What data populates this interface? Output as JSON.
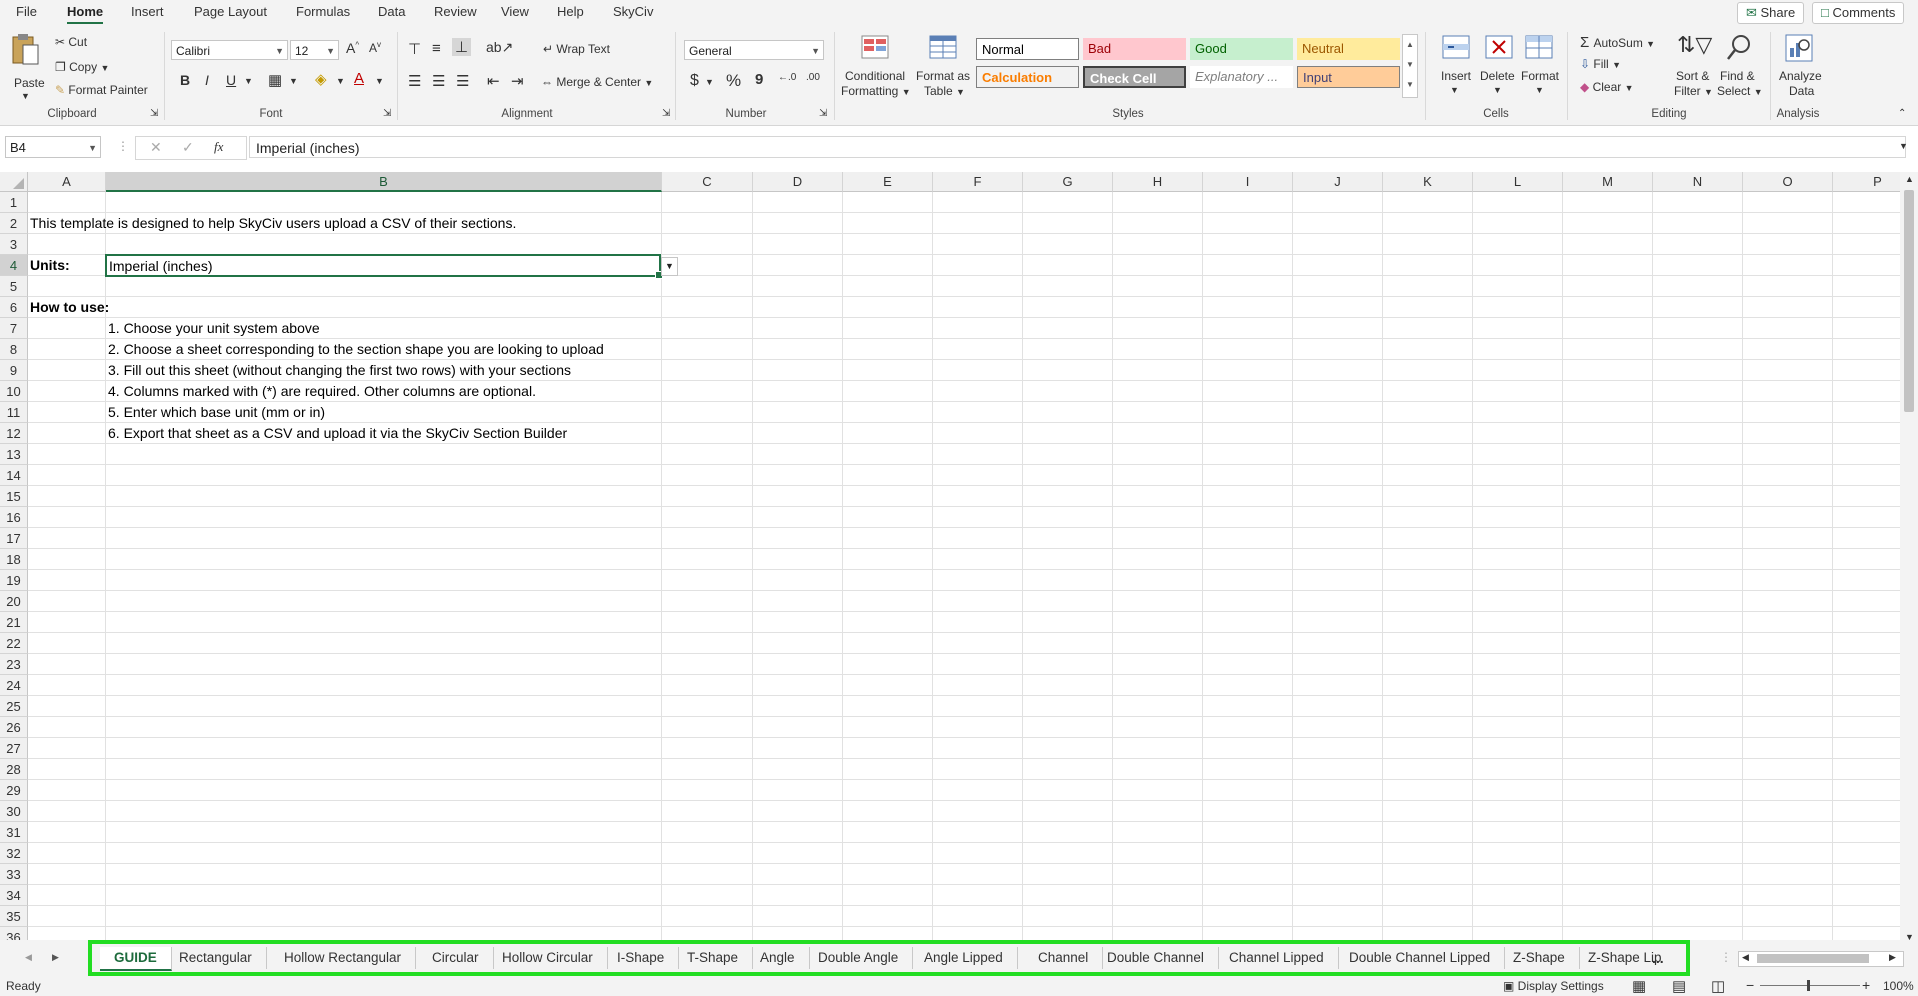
{
  "menu": {
    "tabs": [
      "File",
      "Home",
      "Insert",
      "Page Layout",
      "Formulas",
      "Data",
      "Review",
      "View",
      "Help",
      "SkyCiv"
    ],
    "share": "Share",
    "comments": "Comments"
  },
  "ribbon": {
    "clipboard": {
      "paste": "Paste",
      "cut": "Cut",
      "copy": "Copy",
      "format_painter": "Format Painter",
      "label": "Clipboard"
    },
    "font": {
      "name": "Calibri",
      "size": "12",
      "bold": "B",
      "italic": "I",
      "underline": "U",
      "label": "Font"
    },
    "alignment": {
      "wrap": "Wrap Text",
      "merge": "Merge & Center",
      "label": "Alignment"
    },
    "number": {
      "format": "General",
      "currency": "$",
      "percent": "%",
      "comma": "9",
      "label": "Number"
    },
    "styles": {
      "conditional_1": "Conditional",
      "conditional_2": "Formatting",
      "format_table_1": "Format as",
      "format_table_2": "Table",
      "cells": [
        {
          "text": "Normal",
          "bg": "#ffffff",
          "fg": "#000000"
        },
        {
          "text": "Bad",
          "bg": "#ffc7ce",
          "fg": "#9c0006"
        },
        {
          "text": "Good",
          "bg": "#c6efce",
          "fg": "#006100"
        },
        {
          "text": "Neutral",
          "bg": "#ffeb9c",
          "fg": "#9c5700"
        },
        {
          "text": "Calculation",
          "bg": "#f2f2f2",
          "fg": "#fa7d00"
        },
        {
          "text": "Check Cell",
          "bg": "#a5a5a5",
          "fg": "#ffffff"
        },
        {
          "text": "Explanatory ...",
          "bg": "#ffffff",
          "fg": "#7f7f7f"
        },
        {
          "text": "Input",
          "bg": "#ffcc99",
          "fg": "#3f3f76"
        }
      ],
      "label": "Styles"
    },
    "cells": {
      "insert": "Insert",
      "delete": "Delete",
      "format": "Format",
      "label": "Cells"
    },
    "editing": {
      "autosum": "AutoSum",
      "fill": "Fill",
      "clear": "Clear",
      "sort_1": "Sort &",
      "sort_2": "Filter",
      "find_1": "Find &",
      "find_2": "Select",
      "label": "Editing"
    },
    "analysis": {
      "analyze_1": "Analyze",
      "analyze_2": "Data",
      "label": "Analysis"
    }
  },
  "formula_bar": {
    "name_box": "B4",
    "fx": "fx",
    "value": "Imperial (inches)"
  },
  "grid": {
    "columns": [
      "A",
      "B",
      "C",
      "D",
      "E",
      "F",
      "G",
      "H",
      "I",
      "J",
      "K",
      "L",
      "M",
      "N",
      "O",
      "P"
    ],
    "rows": [
      "1",
      "2",
      "3",
      "4",
      "5",
      "6",
      "7",
      "8",
      "9",
      "10",
      "11",
      "12",
      "13",
      "14",
      "15",
      "16",
      "17",
      "18",
      "19",
      "20",
      "21",
      "22",
      "23",
      "24",
      "25",
      "26",
      "27",
      "28",
      "29",
      "30",
      "31",
      "32",
      "33",
      "34",
      "35",
      "36"
    ],
    "a2": "This template is designed to help SkyCiv users upload a CSV of their sections.",
    "a4": "Units:",
    "b4": "Imperial (inches)",
    "a6": "How to use:",
    "steps": [
      "1. Choose your unit system above",
      "2. Choose a sheet corresponding to the section shape you are looking to upload",
      "3. Fill out this sheet (without changing the first two rows) with your sections",
      "4. Columns marked with (*) are required. Other columns are optional.",
      "5. Enter which base unit (mm or in)",
      "6. Export that sheet as a CSV and upload it via the SkyCiv Section Builder"
    ]
  },
  "sheet_tabs": [
    "GUIDE",
    "Rectangular",
    "Hollow Rectangular",
    "Circular",
    "Hollow Circular",
    "I-Shape",
    "T-Shape",
    "Angle",
    "Double Angle",
    "Angle Lipped",
    "Channel",
    "Double Channel",
    "Channel Lipped",
    "Double Channel Lipped",
    "Z-Shape",
    "Z-Shape Lip"
  ],
  "sheet_tabs_more": "...",
  "status": {
    "ready": "Ready",
    "display": "Display Settings",
    "zoom": "100%"
  },
  "colors": {
    "accent": "#217346",
    "highlight": "#22dd22"
  }
}
